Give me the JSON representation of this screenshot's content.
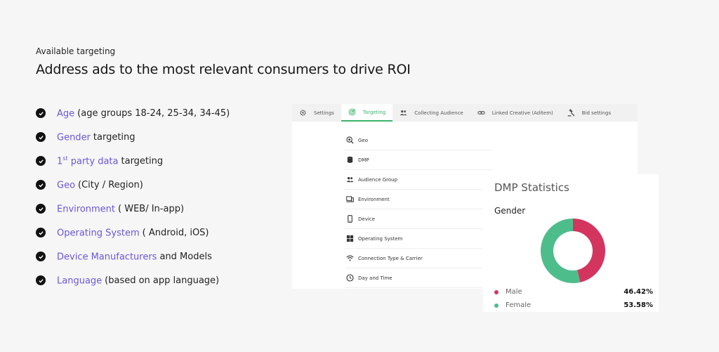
{
  "header": {
    "eyebrow": "Available targeting",
    "headline": "Address ads to the most relevant consumers to drive ROI"
  },
  "features": [
    {
      "highlight": "Age",
      "sup": "",
      "highlight_rest": "",
      "rest": "(age groups 18-24, 25-34, 34-45)"
    },
    {
      "highlight": "Gender",
      "sup": "",
      "highlight_rest": "",
      "rest": "targeting"
    },
    {
      "highlight": "1",
      "sup": "st",
      "highlight_rest": " party data",
      "rest": "targeting"
    },
    {
      "highlight": "Geo",
      "sup": "",
      "highlight_rest": "",
      "rest": "(City / Region)"
    },
    {
      "highlight": "Environment",
      "sup": "",
      "highlight_rest": "",
      "rest": "( WEB/ In-app)"
    },
    {
      "highlight": "Operating System",
      "sup": "",
      "highlight_rest": "",
      "rest": "( Android, iOS)"
    },
    {
      "highlight": "Device Manufacturers",
      "sup": "",
      "highlight_rest": "",
      "rest": "and Models"
    },
    {
      "highlight": "Language",
      "sup": "",
      "highlight_rest": "",
      "rest": "(based on app language)"
    }
  ],
  "tabs": [
    {
      "label": "Settings",
      "icon": "gear-icon"
    },
    {
      "label": "Targeting",
      "icon": "target-icon"
    },
    {
      "label": "Collecting Audience",
      "icon": "people-icon"
    },
    {
      "label": "Linked Creative (Aditem)",
      "icon": "link-icon"
    },
    {
      "label": "Bid settings",
      "icon": "gavel-icon"
    }
  ],
  "targeting_items": [
    {
      "label": "Geo",
      "icon": "geo-search-icon"
    },
    {
      "label": "DMP",
      "icon": "database-icon"
    },
    {
      "label": "Audience Group",
      "icon": "people-icon"
    },
    {
      "label": "Environment",
      "icon": "devices-icon"
    },
    {
      "label": "Device",
      "icon": "phone-icon"
    },
    {
      "label": "Operating System",
      "icon": "windows-icon"
    },
    {
      "label": "Connection Type & Carrier",
      "icon": "wifi-icon"
    },
    {
      "label": "Day and Time",
      "icon": "clock-icon"
    }
  ],
  "dmp": {
    "title": "DMP Statistics",
    "subtitle": "Gender"
  },
  "chart_data": {
    "type": "pie",
    "title": "",
    "series": [
      {
        "name": "Male",
        "value": 46.42,
        "label": "46.42%",
        "color": "#d3355f"
      },
      {
        "name": "Female",
        "value": 53.58,
        "label": "53.58%",
        "color": "#4dbd8c"
      }
    ]
  }
}
